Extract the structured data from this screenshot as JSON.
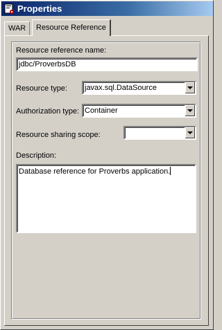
{
  "window": {
    "title": "Properties"
  },
  "tabs": [
    {
      "label": "WAR",
      "active": false
    },
    {
      "label": "Resource Reference",
      "active": true
    }
  ],
  "form": {
    "resource_name": {
      "label": "Resource reference name:",
      "value": "jdbc/ProverbsDB"
    },
    "resource_type": {
      "label": "Resource type:",
      "value": "javax.sql.DataSource"
    },
    "auth_type": {
      "label": "Authorization type:",
      "value": "Container"
    },
    "sharing_scope": {
      "label": "Resource sharing scope:",
      "value": ""
    },
    "description": {
      "label": "Description:",
      "value": "Database reference for Proverbs application."
    }
  },
  "colors": {
    "titlebar_start": "#0a246a",
    "titlebar_end": "#a6caf0",
    "face": "#d4d0c8"
  },
  "icons": {
    "app": "properties-app-icon",
    "dropdown": "chevron-down-icon"
  }
}
